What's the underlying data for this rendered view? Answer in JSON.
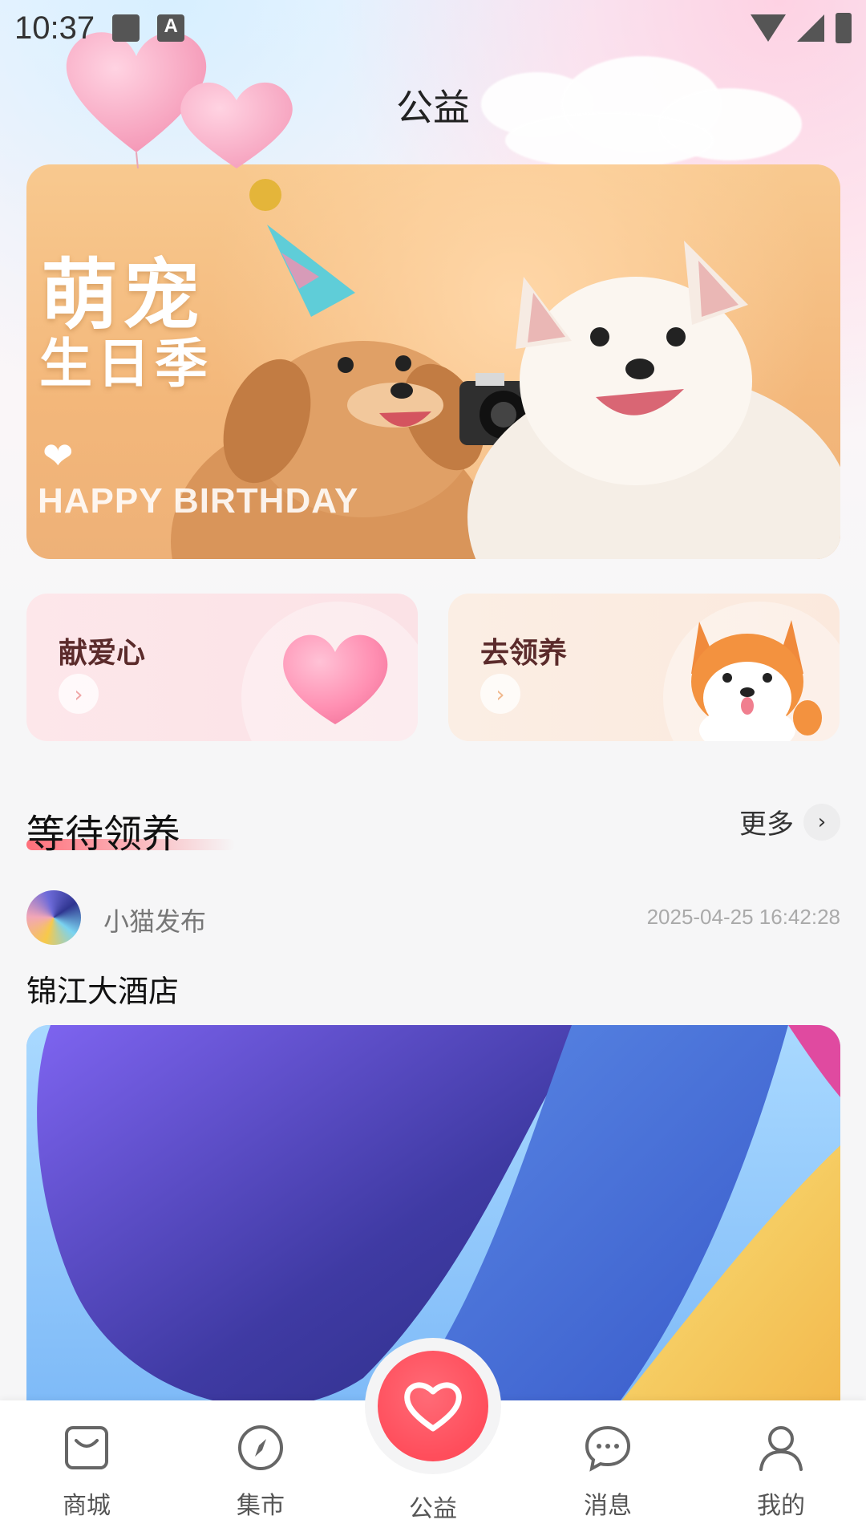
{
  "status_bar": {
    "time": "10:37",
    "icons": [
      "image-icon",
      "a-icon",
      "wifi-icon",
      "signal-icon",
      "battery-charging-icon"
    ]
  },
  "header": {
    "title": "公益"
  },
  "banner": {
    "title_line1": "萌宠",
    "title_line2": "生日季",
    "subtitle": "HAPPY BIRTHDAY"
  },
  "cards": [
    {
      "title": "献爱心",
      "icon": "heart-icon"
    },
    {
      "title": "去领养",
      "icon": "dog-icon"
    }
  ],
  "section": {
    "title": "等待领养",
    "more_label": "更多"
  },
  "post": {
    "author": "小猫发布",
    "time": "2025-04-25 16:42:28",
    "title": "锦江大酒店"
  },
  "nav": {
    "items": [
      {
        "label": "商城",
        "icon": "bag-icon"
      },
      {
        "label": "集市",
        "icon": "compass-icon"
      },
      {
        "label": "公益",
        "icon": "heart-icon"
      },
      {
        "label": "消息",
        "icon": "message-icon"
      },
      {
        "label": "我的",
        "icon": "user-icon"
      }
    ]
  },
  "colors": {
    "accent": "#ff4d5b",
    "section_underline": "#ff6f7a",
    "banner_bg": "#f3b77a"
  }
}
